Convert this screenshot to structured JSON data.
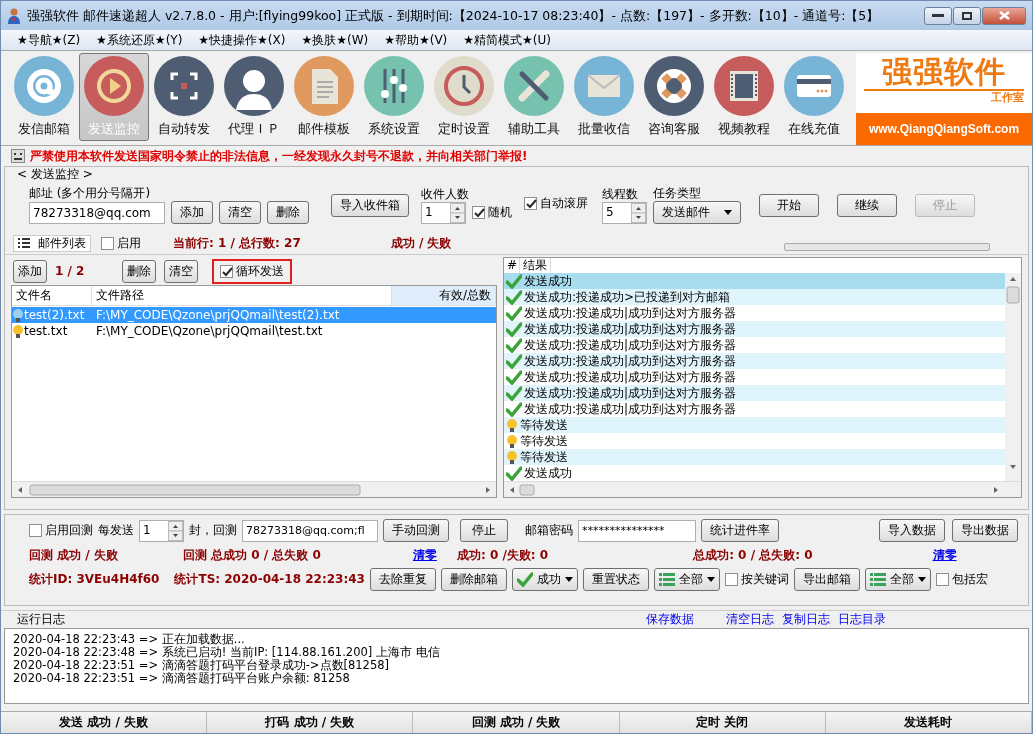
{
  "window": {
    "title": "强强软件 邮件速递超人 v2.7.8.0 - 用户:[flying99koo] 正式版 - 到期时间:【2024-10-17 08:23:40】- 点数:【197】- 多开数:【10】- 通道号:【5】"
  },
  "menu": [
    "★导航★(Z)",
    "★系统还原★(Y)",
    "★快捷操作★(X)",
    "★换肤★(W)",
    "★帮助★(V)",
    "★精简模式★(U)"
  ],
  "toolbar": [
    {
      "label": "发信邮箱",
      "selected": false
    },
    {
      "label": "发送监控",
      "selected": true
    },
    {
      "label": "自动转发",
      "selected": false
    },
    {
      "label": "代理ＩＰ",
      "selected": false
    },
    {
      "label": "邮件模板",
      "selected": false
    },
    {
      "label": "系统设置",
      "selected": false
    },
    {
      "label": "定时设置",
      "selected": false
    },
    {
      "label": "辅助工具",
      "selected": false
    },
    {
      "label": "批量收信",
      "selected": false
    },
    {
      "label": "咨询客服",
      "selected": false
    },
    {
      "label": "视频教程",
      "selected": false
    },
    {
      "label": "在线充值",
      "selected": false
    }
  ],
  "logo": {
    "name": "强强软件",
    "subtitle": "工作室",
    "url": "www.QiangQiangSoft.com"
  },
  "warning": "严禁使用本软件发送国家明令禁止的非法信息，一经发现永久封号不退款，并向相关部门举报!",
  "group_title": "< 发送监控 >",
  "send": {
    "address_label": "邮址 (多个用分号隔开)",
    "address_value": "78273318@qq.com",
    "add": "添加",
    "clear": "清空",
    "delete": "删除",
    "import": "导入收件箱",
    "recipients_label": "收件人数",
    "recipients_value": "1",
    "random": {
      "label": "随机",
      "checked": true
    },
    "autoscroll": {
      "label": "自动滚屏",
      "checked": true
    },
    "threads_label": "线程数",
    "threads_value": "5",
    "task_label": "任务类型",
    "task_value": "发送邮件",
    "buttons": [
      {
        "label": "开始",
        "disabled": false
      },
      {
        "label": "继续",
        "disabled": false
      },
      {
        "label": "停止",
        "disabled": true
      }
    ]
  },
  "list_bar": {
    "tab": "邮件列表",
    "enable": {
      "label": "启用",
      "checked": false
    },
    "current": "当前行: 1 / 总行数: 27",
    "result": "成功 / 失败",
    "progress": {
      "level": 0
    }
  },
  "files": {
    "add": "添加",
    "count": "1 / 2",
    "delete": "删除",
    "clear": "清空",
    "loop": {
      "label": "循环发送",
      "checked": true,
      "outlined": true
    },
    "columns": [
      "文件名",
      "文件路径",
      "有效/总数"
    ],
    "rows": [
      {
        "name": "test(2).txt",
        "path": "F:\\MY_CODE\\Qzone\\prjQQmail\\test(2).txt",
        "selected": true
      },
      {
        "name": "test.txt",
        "path": "F:\\MY_CODE\\Qzone\\prjQQmail\\test.txt",
        "selected": false
      }
    ]
  },
  "results": {
    "columns": [
      "#",
      "结果"
    ],
    "rows": [
      {
        "text": "发送成功",
        "kind": "success",
        "selected": true
      },
      {
        "text": "发送成功:投递成功>已投递到对方邮箱",
        "kind": "success",
        "selected": false
      },
      {
        "text": "发送成功:投递成功|成功到达对方服务器",
        "kind": "success",
        "selected": false
      },
      {
        "text": "发送成功:投递成功|成功到达对方服务器",
        "kind": "success",
        "selected": false
      },
      {
        "text": "发送成功:投递成功|成功到达对方服务器",
        "kind": "success",
        "selected": false
      },
      {
        "text": "发送成功:投递成功|成功到达对方服务器",
        "kind": "success",
        "selected": false
      },
      {
        "text": "发送成功:投递成功|成功到达对方服务器",
        "kind": "success",
        "selected": false
      },
      {
        "text": "发送成功:投递成功|成功到达对方服务器",
        "kind": "success",
        "selected": false
      },
      {
        "text": "发送成功:投递成功|成功到达对方服务器",
        "kind": "success",
        "selected": false
      },
      {
        "text": "等待发送",
        "kind": "waiting",
        "selected": false
      },
      {
        "text": "等待发送",
        "kind": "waiting",
        "selected": false
      },
      {
        "text": "等待发送",
        "kind": "waiting",
        "selected": false
      },
      {
        "text": "发送成功",
        "kind": "success",
        "selected": false
      }
    ]
  },
  "recheck": {
    "enable": {
      "label": "启用回测",
      "checked": false
    },
    "every_label": "每发送",
    "every_value": "1",
    "unit_label": "封，回测",
    "address_value": "78273318@qq.com;fl",
    "manual": "手动回测",
    "stop": "停止",
    "password_label": "邮箱密码",
    "password_value": "***************",
    "stats_button": "统计进件率",
    "import": "导入数据",
    "export": "导出数据"
  },
  "stats": {
    "recheck_result": "回测 成功 / 失败",
    "recheck_total": "回测 总成功 0 / 总失败 0",
    "clear1": "清零",
    "success": "成功: 0 /失败: 0",
    "total": "总成功: 0 / 总失败: 0",
    "clear2": "清零",
    "stat_id": "统计ID: 3VEu4H4f60",
    "stat_ts": "统计TS: 2020-04-18 22:23:43",
    "dedupe": "去除重复",
    "delete_mail": "删除邮箱",
    "status_filter": "成功",
    "reset": "重置状态",
    "filter1": "全部",
    "keyword": {
      "label": "按关键词",
      "checked": false
    },
    "export_mail": "导出邮箱",
    "filter2": "全部",
    "macro": {
      "label": "包括宏",
      "checked": false
    }
  },
  "log": {
    "title": "运行日志",
    "links": [
      "保存数据",
      "清空日志",
      "复制日志",
      "日志目录"
    ],
    "lines": [
      "2020-04-18 22:23:43 => 正在加载数据...",
      "2020-04-18 22:23:48 => 系统已启动! 当前IP: [114.88.161.200] 上海市 电信",
      "2020-04-18 22:23:51 => 滴滴答题打码平台登录成功->点数[81258]",
      "2020-04-18 22:23:51 => 滴滴答题打码平台账户余额: 81258"
    ]
  },
  "status_bar": [
    "发送 成功 / 失败",
    "打码 成功 / 失败",
    "回测 成功 / 失败",
    "定时 关闭",
    "发送耗时"
  ]
}
